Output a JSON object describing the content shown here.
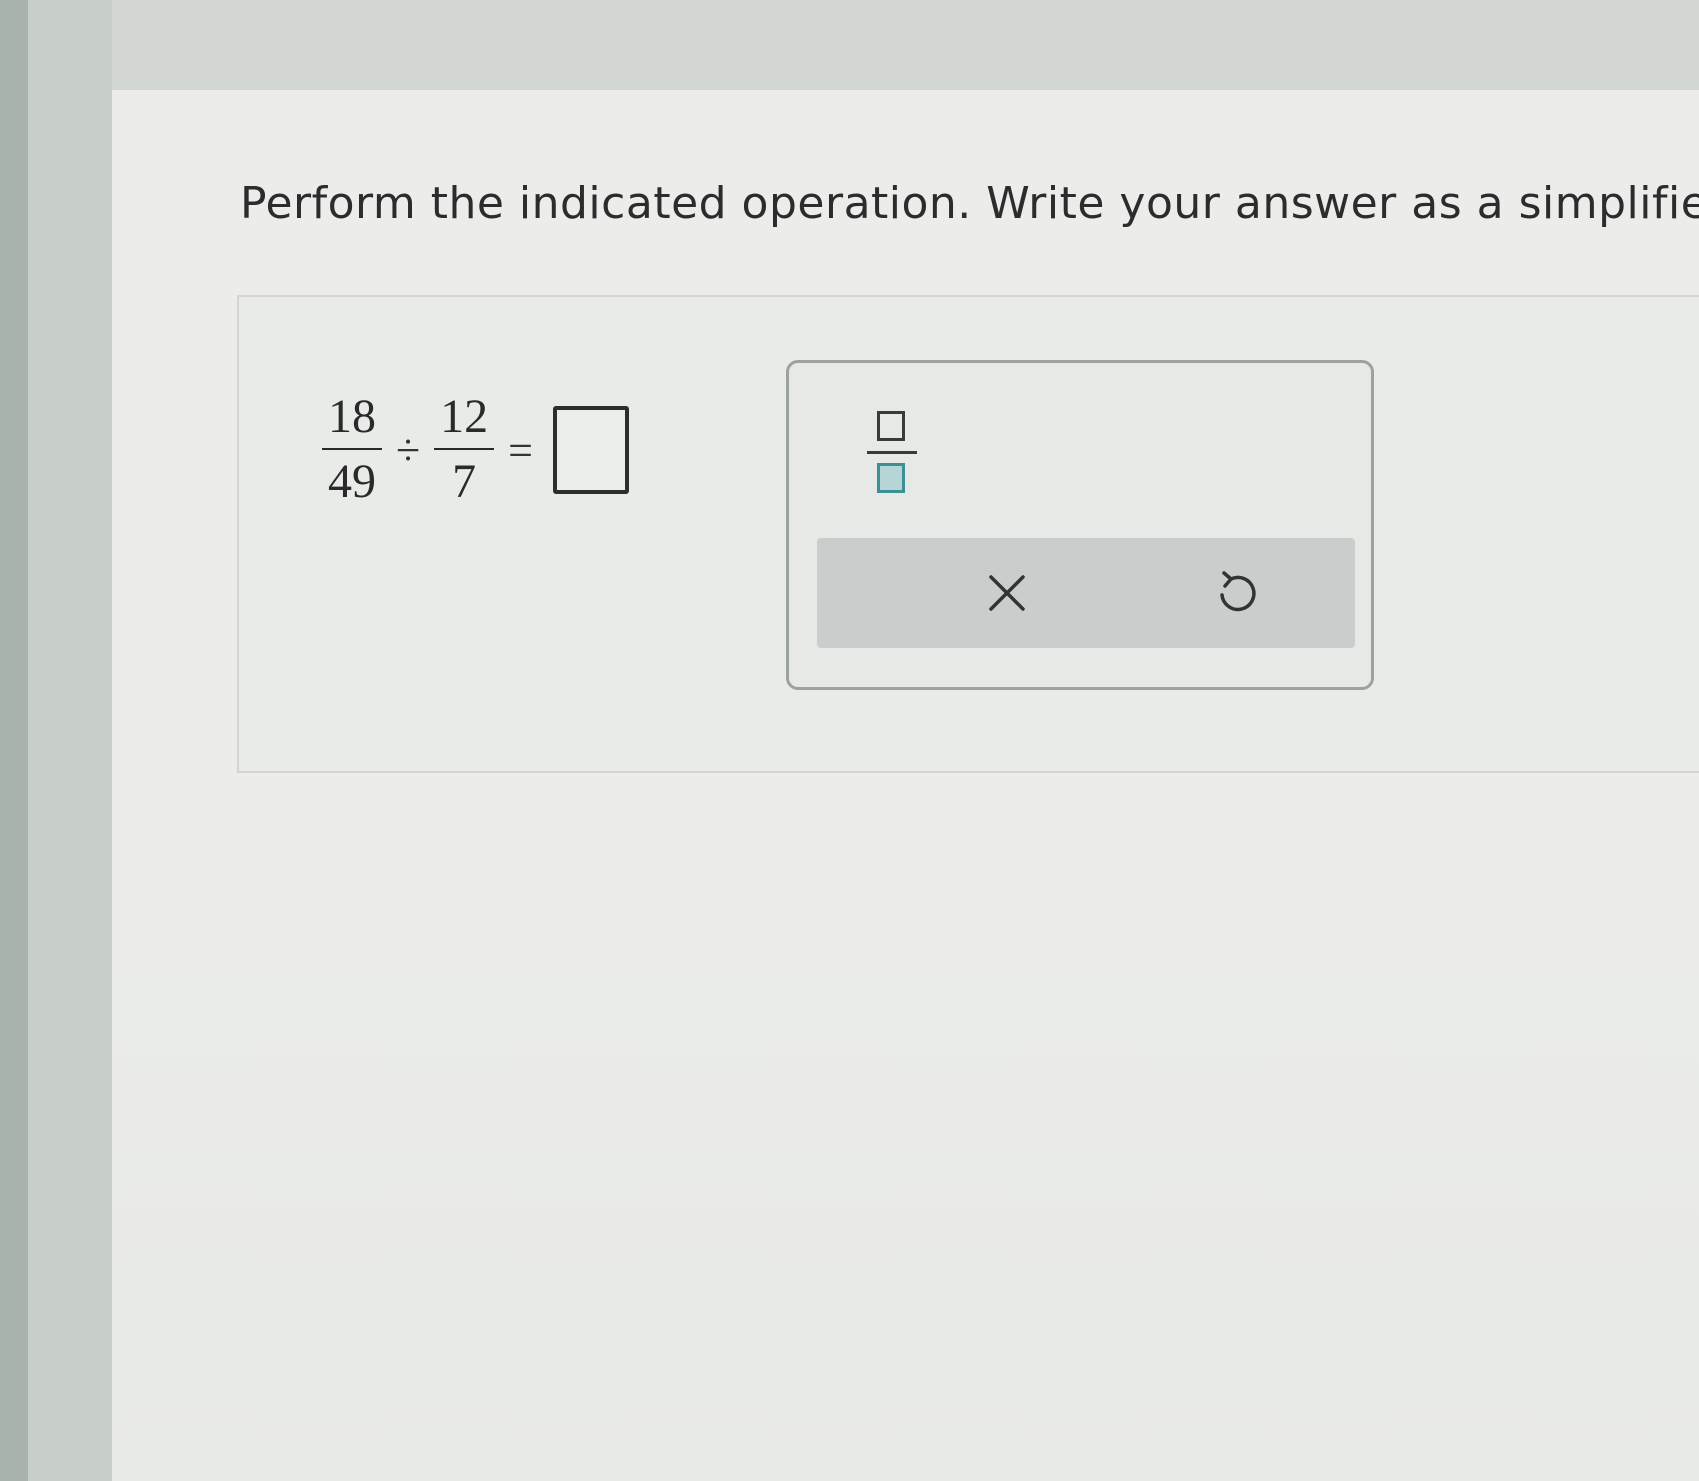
{
  "question": {
    "instruction": "Perform the indicated operation. Write your answer as a simplifie"
  },
  "expression": {
    "fraction1": {
      "numerator": "18",
      "denominator": "49"
    },
    "operator": "÷",
    "fraction2": {
      "numerator": "12",
      "denominator": "7"
    },
    "equals": "="
  },
  "answer_input": {
    "value": ""
  },
  "toolbox": {
    "tools": [
      {
        "name": "fraction-tool",
        "icon": "fraction-template-icon"
      }
    ],
    "actions": [
      {
        "name": "clear",
        "icon": "close-icon"
      },
      {
        "name": "undo",
        "icon": "undo-icon"
      }
    ]
  },
  "colors": {
    "accent_teal": "#3c8f93",
    "text": "#2c2c2c",
    "panel_border": "#9aa39f",
    "action_bar": "#c9cdcc"
  }
}
